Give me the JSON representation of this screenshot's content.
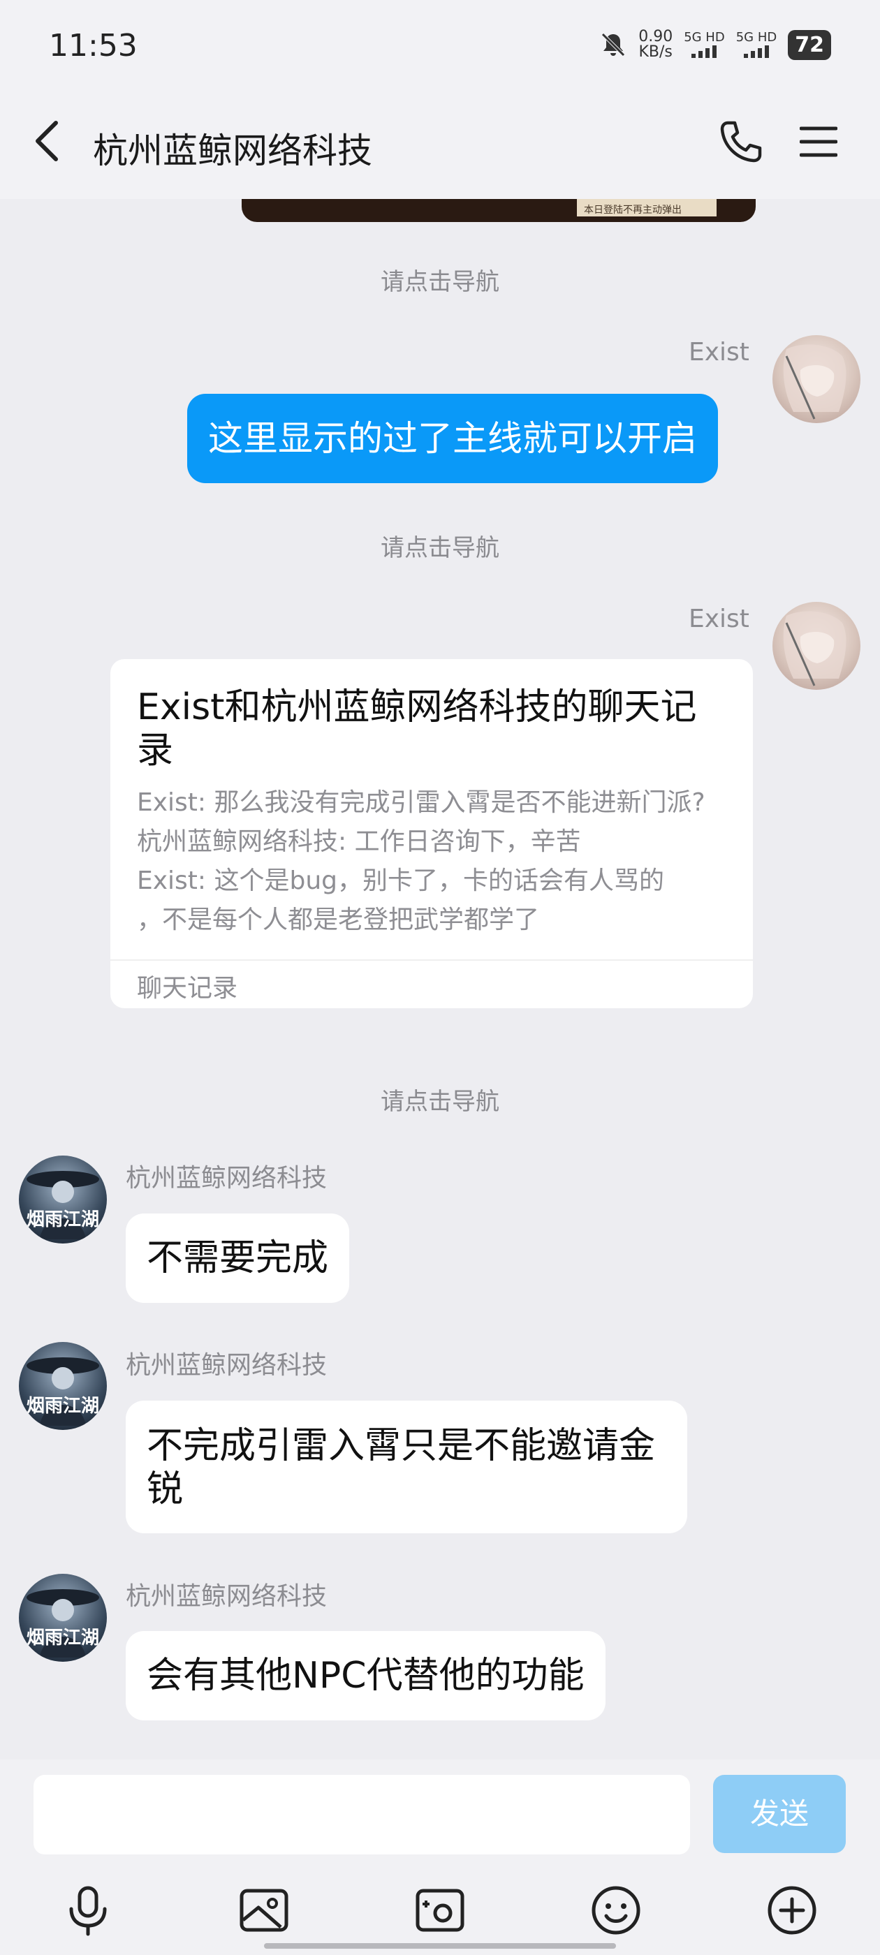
{
  "status_bar": {
    "time": "11:53",
    "net_speed_value": "0.90",
    "net_speed_unit": "KB/s",
    "signal1": "5G HD",
    "signal2": "5G HD",
    "battery": "72"
  },
  "header": {
    "title": "杭州蓝鲸网络科技"
  },
  "top_image": {
    "caption": "本日登陆不再主动弹出"
  },
  "messages": {
    "system1": "请点击导航",
    "m1_sender": "Exist",
    "m1_text": "这里显示的过了主线就可以开启",
    "system2": "请点击导航",
    "m2_sender": "Exist",
    "card": {
      "title": "Exist和杭州蓝鲸网络科技的聊天记录",
      "lines": [
        "Exist: 那么我没有完成引雷入霄是否不能进新门派?",
        "杭州蓝鲸网络科技: 工作日咨询下，辛苦",
        "Exist: 这个是bug，别卡了，卡的话会有人骂的",
        "，不是每个人都是老登把武学都学了"
      ],
      "footer": "聊天记录"
    },
    "system3": "请点击导航",
    "m3_sender": "杭州蓝鲸网络科技",
    "m3_text": "不需要完成",
    "m4_sender": "杭州蓝鲸网络科技",
    "m4_text": "不完成引雷入霄只是不能邀请金锐",
    "m5_sender": "杭州蓝鲸网络科技",
    "m5_text": "会有其他NPC代替他的功能",
    "avatar_other_text": "烟雨江湖"
  },
  "input": {
    "placeholder": "",
    "send_label": "发送"
  },
  "colors": {
    "accent": "#0a99f8",
    "send_disabled": "#8ecdf6",
    "background": "#ededf1"
  }
}
